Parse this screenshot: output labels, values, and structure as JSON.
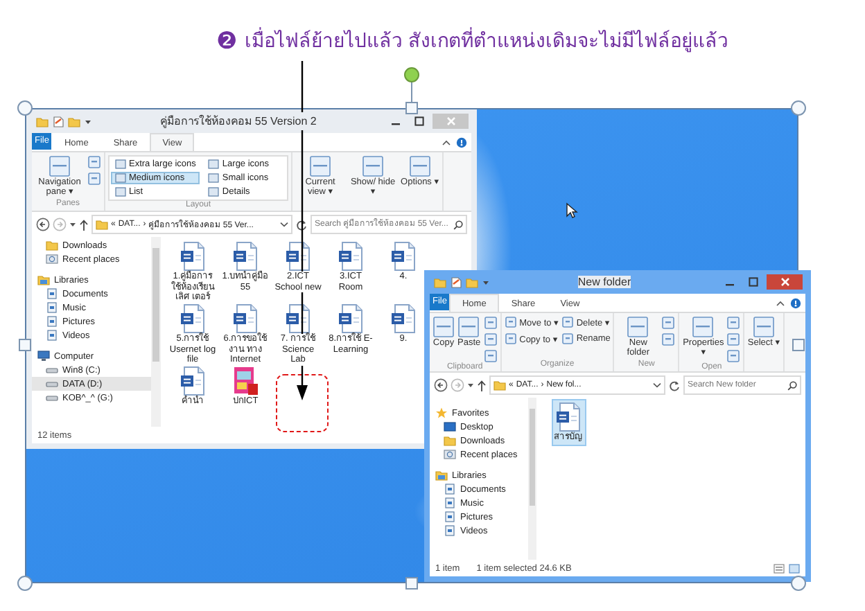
{
  "caption": {
    "marker": "❷",
    "text": "เมื่อไฟล์ย้ายไปแล้ว สังเกตที่ตำแหน่งเดิมจะไม่มีไฟล์อยู่แล้ว"
  },
  "windows": [
    {
      "active": false,
      "title": "คู่มือการใช้ห้องคอม 55 Version 2",
      "tabs": [
        {
          "label": "File",
          "kind": "file",
          "selected": false
        },
        {
          "label": "Home",
          "kind": "tab",
          "selected": false
        },
        {
          "label": "Share",
          "kind": "tab",
          "selected": false
        },
        {
          "label": "View",
          "kind": "tab",
          "selected": true
        }
      ],
      "ribbon": [
        {
          "label": "Panes",
          "items": [
            {
              "kind": "large",
              "label": "Navigation pane ▾"
            },
            {
              "kind": "icon"
            },
            {
              "kind": "icon"
            }
          ]
        },
        {
          "label": "Layout",
          "items": [
            {
              "kind": "gallery",
              "label": "Extra large icons",
              "selected": false
            },
            {
              "kind": "gallery",
              "label": "Large icons",
              "selected": false
            },
            {
              "kind": "gallery",
              "label": "Medium icons",
              "selected": true
            },
            {
              "kind": "gallery",
              "label": "Small icons",
              "selected": false
            },
            {
              "kind": "gallery",
              "label": "List",
              "selected": false
            },
            {
              "kind": "gallery",
              "label": "Details",
              "selected": false
            }
          ]
        },
        {
          "items": [
            {
              "kind": "large",
              "label": "Current view ▾"
            },
            {
              "kind": "large",
              "label": "Show/ hide ▾"
            },
            {
              "kind": "large",
              "label": "Options ▾"
            }
          ]
        }
      ],
      "address": {
        "prefix": "«",
        "separator": "›",
        "parts": [
          "DAT...",
          "คู่มือการใช้ห้องคอม 55 Ver..."
        ]
      },
      "search": {
        "placeholder": "Search คู่มือการใช้ห้องคอม 55 Ver..."
      },
      "nav": [
        {
          "kind": "folder",
          "label": "Downloads",
          "selected": false
        },
        {
          "kind": "recent",
          "label": "Recent places",
          "selected": false
        },
        {
          "kind": "libraries",
          "label": "Libraries",
          "selected": false
        },
        {
          "kind": "library",
          "label": "Documents",
          "selected": false
        },
        {
          "kind": "library",
          "label": "Music",
          "selected": false
        },
        {
          "kind": "library",
          "label": "Pictures",
          "selected": false
        },
        {
          "kind": "library",
          "label": "Videos",
          "selected": false
        },
        {
          "kind": "computer",
          "label": "Computer",
          "selected": false
        },
        {
          "kind": "drive",
          "label": "Win8 (C:)",
          "selected": false
        },
        {
          "kind": "drive",
          "label": "DATA (D:)",
          "selected": true
        },
        {
          "kind": "drive",
          "label": "KOB^_^ (G:)",
          "selected": false
        }
      ],
      "files": [
        {
          "kind": "word",
          "name": "1.คู่มือการใช้ห้องเรียนเลิศ เตอร์",
          "selected": false
        },
        {
          "kind": "word",
          "name": "1.บทนำคู่มือ 55",
          "selected": false
        },
        {
          "kind": "word",
          "name": "2.ICT School new",
          "selected": false
        },
        {
          "kind": "word",
          "name": "3.ICT Room",
          "selected": false
        },
        {
          "kind": "word",
          "name": "4.",
          "selected": false
        },
        {
          "kind": "word",
          "name": "5.การใช้ Usernet log file",
          "selected": false
        },
        {
          "kind": "word",
          "name": "6.การขอใช้งาน ทาง Internet",
          "selected": false
        },
        {
          "kind": "word",
          "name": "7. การใช้ Science Lab",
          "selected": false
        },
        {
          "kind": "word",
          "name": "8.การใช้ E-Learning",
          "selected": false
        },
        {
          "kind": "word",
          "name": "9.",
          "selected": false
        },
        {
          "kind": "word",
          "name": "คำนำ",
          "selected": false
        },
        {
          "kind": "pdf",
          "name": "ปกICT",
          "selected": false
        }
      ],
      "status": [
        "12 items"
      ]
    },
    {
      "active": true,
      "title": "New folder",
      "tabs": [
        {
          "label": "File",
          "kind": "file",
          "selected": false
        },
        {
          "label": "Home",
          "kind": "tab",
          "selected": true
        },
        {
          "label": "Share",
          "kind": "tab",
          "selected": false
        },
        {
          "label": "View",
          "kind": "tab",
          "selected": false
        }
      ],
      "ribbon": [
        {
          "label": "Clipboard",
          "items": [
            {
              "kind": "large",
              "label": "Copy"
            },
            {
              "kind": "large",
              "label": "Paste"
            },
            {
              "kind": "icon"
            },
            {
              "kind": "icon"
            },
            {
              "kind": "icon"
            }
          ]
        },
        {
          "label": "Organize",
          "items": [
            {
              "kind": "small",
              "label": "Move to ▾"
            },
            {
              "kind": "small",
              "label": "Delete ▾"
            },
            {
              "kind": "small",
              "label": "Copy to ▾"
            },
            {
              "kind": "small",
              "label": "Rename"
            }
          ]
        },
        {
          "label": "New",
          "items": [
            {
              "kind": "large",
              "label": "New folder"
            },
            {
              "kind": "icon"
            },
            {
              "kind": "icon"
            }
          ]
        },
        {
          "label": "Open",
          "items": [
            {
              "kind": "large",
              "label": "Properties ▾"
            },
            {
              "kind": "icon"
            },
            {
              "kind": "icon"
            },
            {
              "kind": "icon"
            }
          ]
        },
        {
          "items": [
            {
              "kind": "large",
              "label": "Select ▾"
            }
          ]
        }
      ],
      "address": {
        "prefix": "«",
        "separator": "›",
        "parts": [
          "DAT...",
          "New fol..."
        ]
      },
      "search": {
        "placeholder": "Search New folder"
      },
      "nav": [
        {
          "kind": "favorites",
          "label": "Favorites",
          "selected": false
        },
        {
          "kind": "desktop",
          "label": "Desktop",
          "selected": false
        },
        {
          "kind": "folder",
          "label": "Downloads",
          "selected": false
        },
        {
          "kind": "recent",
          "label": "Recent places",
          "selected": false
        },
        {
          "kind": "libraries",
          "label": "Libraries",
          "selected": false
        },
        {
          "kind": "library",
          "label": "Documents",
          "selected": false
        },
        {
          "kind": "library",
          "label": "Music",
          "selected": false
        },
        {
          "kind": "library",
          "label": "Pictures",
          "selected": false
        },
        {
          "kind": "library",
          "label": "Videos",
          "selected": false
        }
      ],
      "files": [
        {
          "kind": "word",
          "name": "สารบัญ",
          "selected": true
        }
      ],
      "status": [
        "1 item",
        "1 item selected  24.6 KB"
      ]
    }
  ]
}
